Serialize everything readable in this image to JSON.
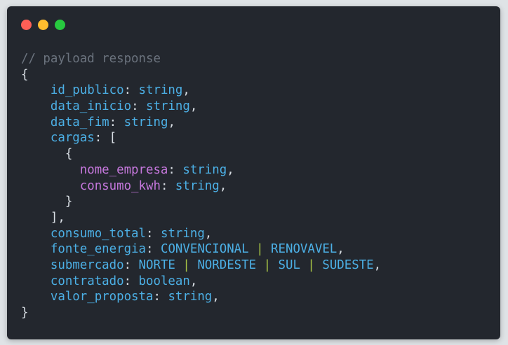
{
  "code": {
    "comment": "// payload response",
    "open_brace": "{",
    "close_brace": "}",
    "fields": [
      {
        "key": "id_publico",
        "type": "string"
      },
      {
        "key": "data_inicio",
        "type": "string"
      },
      {
        "key": "data_fim",
        "type": "string"
      }
    ],
    "cargas": {
      "key": "cargas",
      "open": "[",
      "close": "],",
      "item_open": "{",
      "item_close": "}",
      "item_fields": [
        {
          "key": "nome_empresa",
          "type": "string"
        },
        {
          "key": "consumo_kwh",
          "type": "string"
        }
      ]
    },
    "consumo_total": {
      "key": "consumo_total",
      "type": "string"
    },
    "fonte_energia": {
      "key": "fonte_energia",
      "options": [
        "CONVENCIONAL",
        "RENOVAVEL"
      ]
    },
    "submercado": {
      "key": "submercado",
      "options": [
        "NORTE",
        "NORDESTE",
        "SUL",
        "SUDESTE"
      ]
    },
    "contratado": {
      "key": "contratado",
      "type": "boolean"
    },
    "valor_proposta": {
      "key": "valor_proposta",
      "type": "string"
    }
  },
  "colors": {
    "background": "#23272e",
    "key": "#4cb0e6",
    "nested_key": "#c678dd",
    "separator": "#a8c545",
    "comment": "#6b737e"
  }
}
